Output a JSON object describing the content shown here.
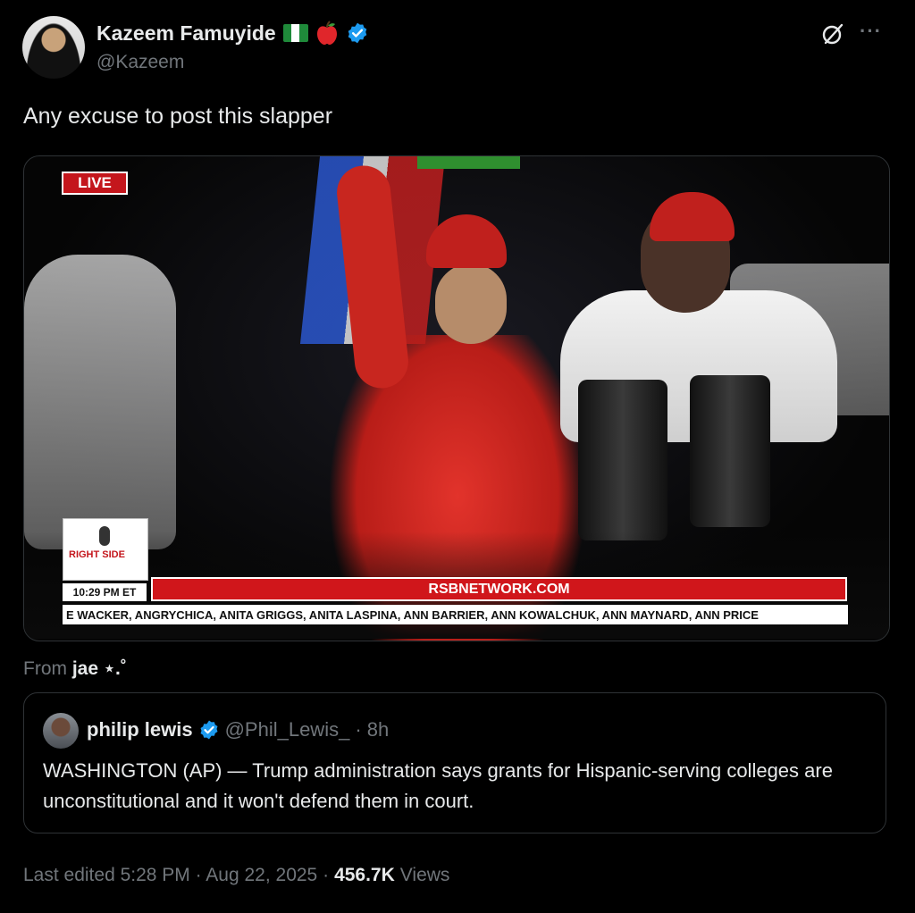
{
  "author": {
    "display_name": "Kazeem Famuyide",
    "handle": "@Kazeem",
    "flag_emoji": "nigeria-flag",
    "extra_emoji": "apple-icon",
    "verified": true
  },
  "tweet": {
    "text": "Any excuse to post this slapper"
  },
  "media": {
    "live_label": "LIVE",
    "logo_text": "RIGHT SIDE",
    "time": "10:29 PM ET",
    "site": "RSBNETWORK.COM",
    "ticker": "E WACKER, ANGRYCHICA, ANITA GRIGGS, ANITA LASPINA, ANN BARRIER, ANN KOWALCHUK, ANN MAYNARD, ANN PRICE"
  },
  "source": {
    "prefix": "From",
    "name": "jae ⋆.˚"
  },
  "quote": {
    "name": "philip lewis",
    "handle": "@Phil_Lewis_",
    "time": "· 8h",
    "text": "WASHINGTON (AP) — Trump administration says grants for Hispanic-serving colleges are unconstitutional and it won't defend them in court."
  },
  "meta": {
    "edited": "Last edited 5:28 PM · Aug 22, 2025 ·",
    "views_count": "456.7K",
    "views_label": "Views"
  },
  "colors": {
    "background": "#000000",
    "text": "#e7e9ea",
    "muted": "#71767b",
    "verified_blue": "#1d9bf0",
    "border": "#2f3336"
  }
}
